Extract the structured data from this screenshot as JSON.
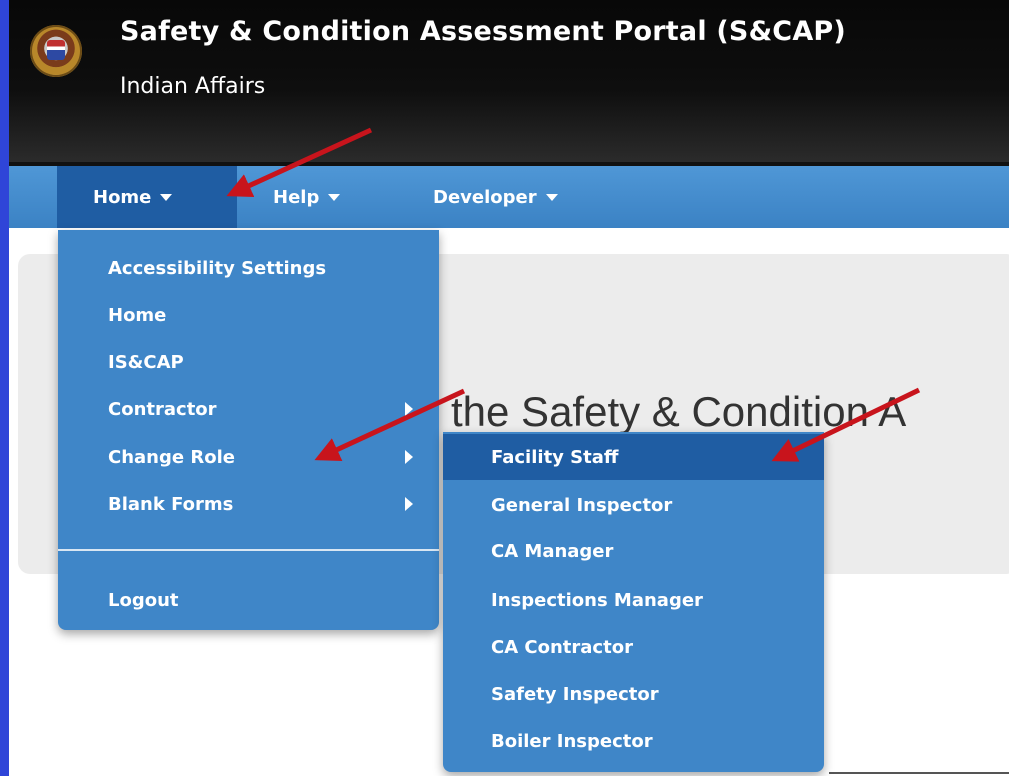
{
  "header": {
    "title": "Safety & Condition Assessment Portal (S&CAP)",
    "subtitle": "Indian Affairs",
    "seal_icon": "department-seal-icon"
  },
  "nav": {
    "items": [
      {
        "label": "Home",
        "active": true
      },
      {
        "label": "Help",
        "active": false
      },
      {
        "label": "Developer",
        "active": false
      }
    ]
  },
  "home_menu": {
    "items": [
      {
        "label": "Accessibility Settings",
        "has_submenu": false
      },
      {
        "label": "Home",
        "has_submenu": false
      },
      {
        "label": "IS&CAP",
        "has_submenu": false
      },
      {
        "label": "Contractor",
        "has_submenu": true
      },
      {
        "label": "Change Role",
        "has_submenu": true
      },
      {
        "label": "Blank Forms",
        "has_submenu": true
      }
    ],
    "logout_label": "Logout"
  },
  "change_role_submenu": {
    "items": [
      {
        "label": "Facility Staff",
        "highlighted": true
      },
      {
        "label": "General Inspector",
        "highlighted": false
      },
      {
        "label": "CA Manager",
        "highlighted": false
      },
      {
        "label": "Inspections Manager",
        "highlighted": false
      },
      {
        "label": "CA Contractor",
        "highlighted": false
      },
      {
        "label": "Safety Inspector",
        "highlighted": false
      },
      {
        "label": "Boiler Inspector",
        "highlighted": false
      }
    ]
  },
  "content": {
    "welcome_text": "the Safety & Condition A"
  },
  "annotations": {
    "arrow_color": "#c8141c"
  },
  "colors": {
    "slide_background": "#2f45d8",
    "header_bg": "#0b0b0b",
    "nav_bg": "#3f86c8",
    "nav_active_bg": "#1f5da3",
    "content_bg": "#ececec"
  }
}
